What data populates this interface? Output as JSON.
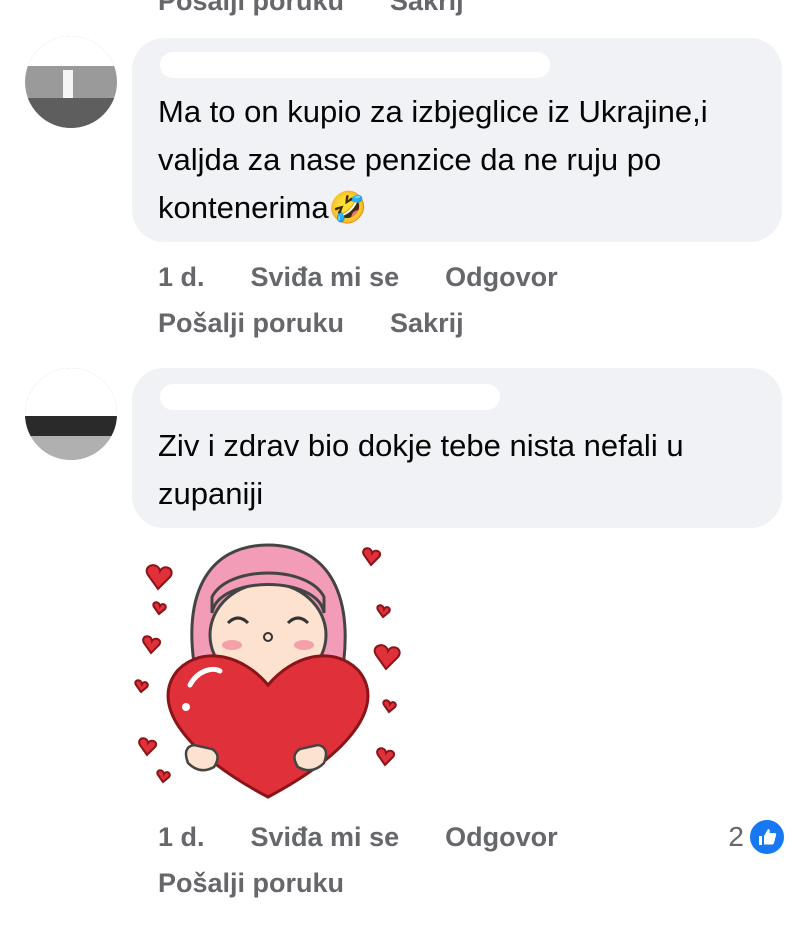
{
  "top_cut": {
    "actions": [
      "Pošalji poruku",
      "Sakrij"
    ]
  },
  "comments": [
    {
      "text": "Ma to on kupio za izbjeglice iz Ukrajine,i valjda za nase penzice da ne ruju po kontenerima",
      "emoji": "🤣",
      "time": "1 d.",
      "like_label": "Sviđa mi se",
      "reply_label": "Odgovor",
      "message_label": "Pošalji poruku",
      "hide_label": "Sakrij"
    },
    {
      "text": "Ziv i zdrav bio dokje tebe nista nefali u zupaniji",
      "time": "1 d.",
      "like_label": "Sviđa mi se",
      "reply_label": "Odgovor",
      "message_label": "Pošalji poruku",
      "reaction_count": "2"
    }
  ],
  "colors": {
    "accent": "#1877f2",
    "bubble": "#f0f2f5",
    "meta": "#65676b",
    "heart": "#e0303a",
    "hair": "#f29cb8"
  },
  "icons": {
    "reaction": "thumbs-up-icon",
    "sticker": "girl-holding-heart-sticker"
  }
}
